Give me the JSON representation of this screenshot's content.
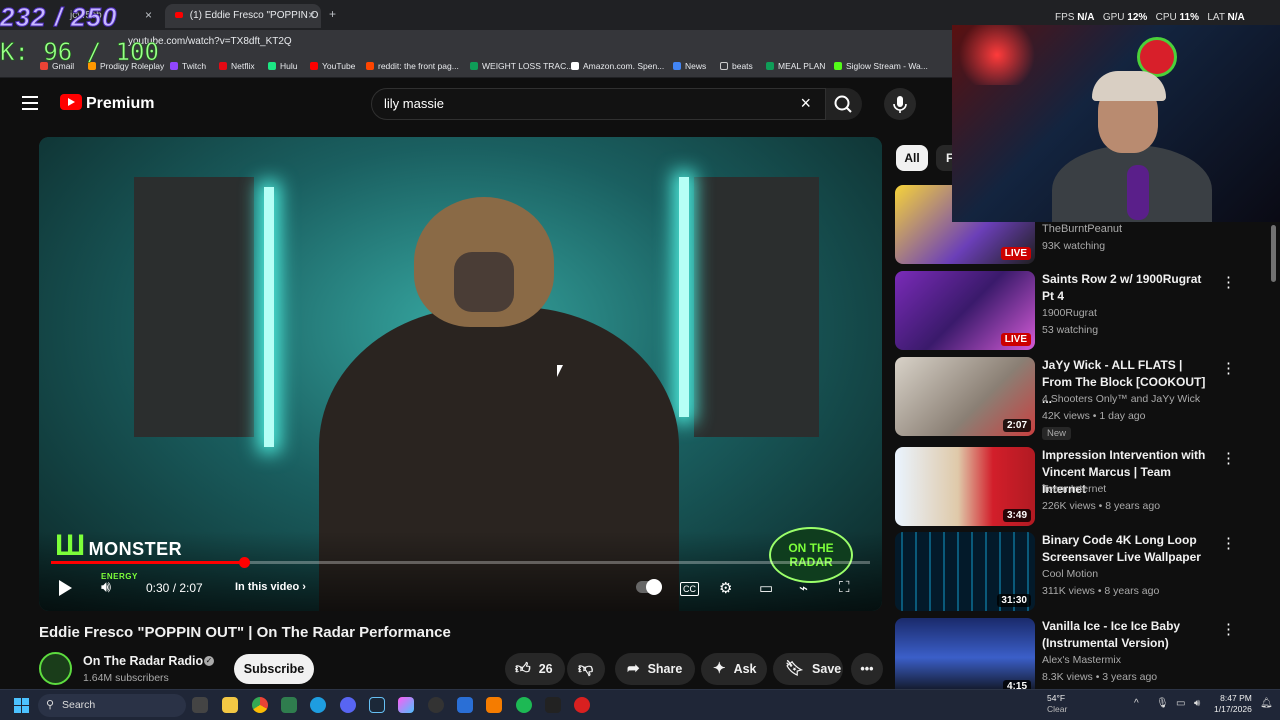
{
  "overlay": {
    "counter_top": "232 / 250",
    "counter_bottom": "K: 96 / 100",
    "perf": [
      {
        "label": "FPS",
        "value": "N/A"
      },
      {
        "label": "GPU",
        "value": "12%"
      },
      {
        "label": "CPU",
        "value": "11%"
      },
      {
        "label": "LAT",
        "value": "N/A"
      }
    ]
  },
  "browser": {
    "tabs": [
      {
        "label": "jcyr5sb",
        "active": false
      },
      {
        "label": "(1) Eddie Fresco \"POPPIN O",
        "active": true
      }
    ],
    "url": "youtube.com/watch?v=TX8dft_KT2Q",
    "bookmarks": [
      "Gmail",
      "Prodigy Roleplay",
      "Twitch",
      "Netflix",
      "Hulu",
      "YouTube",
      "reddit: the front pag...",
      "WEIGHT LOSS TRAC...",
      "Amazon.com. Spen...",
      "News",
      "beats",
      "MEAL PLAN",
      "Siglow Stream - Wa..."
    ]
  },
  "header": {
    "brand": "Premium",
    "search_value": "lily massie"
  },
  "player": {
    "current_time": "0:30",
    "duration": "2:07",
    "time_display": "0:30 / 2:07",
    "progress_fraction": 0.236,
    "chapters_label": "In this video",
    "sponsor_text": "MONSTER",
    "sponsor_sub": "ENERGY",
    "watermark": "ON THE RADAR"
  },
  "video": {
    "title": "Eddie Fresco \"POPPIN OUT\" | On The Radar Performance",
    "channel": "On The Radar Radio",
    "subscribers": "1.64M subscribers",
    "subscribe_label": "Subscribe",
    "likes": "26",
    "share_label": "Share",
    "ask_label": "Ask",
    "save_label": "Save"
  },
  "sidebar": {
    "chips": [
      "All",
      "F"
    ],
    "items": [
      {
        "title": "",
        "channel": "TheBurntPeanut",
        "meta": "93K watching",
        "badge": "LIVE",
        "live": true
      },
      {
        "title": "Saints Row 2 w/ 1900Rugrat Pt 4",
        "channel": "1900Rugrat",
        "meta": "53 watching",
        "badge": "LIVE",
        "live": true
      },
      {
        "title": "JaYy Wick - ALL FLATS | From The Block [COOKOUT] ...",
        "channel": "4 Shooters Only™ and JaYy Wick",
        "meta": "42K views • 1 day ago",
        "badge": "2:07",
        "tag": "New"
      },
      {
        "title": "Impression Intervention with Vincent Marcus | Team Internet",
        "channel": "Team Internet",
        "meta": "226K views • 8 years ago",
        "badge": "3:49"
      },
      {
        "title": "Binary Code 4K Long Loop Screensaver Live Wallpaper",
        "channel": "Cool Motion",
        "meta": "311K views • 8 years ago",
        "badge": "31:30"
      },
      {
        "title": "Vanilla Ice - Ice Ice Baby (Instrumental Version)",
        "channel": "Alex's Mastermix",
        "meta": "8.3K views • 3 years ago",
        "badge": "4:15"
      }
    ]
  },
  "taskbar": {
    "search_placeholder": "Search",
    "temperature": "54°F",
    "weather": "Clear",
    "time": "8:47 PM",
    "date": "1/17/2026"
  },
  "colors": {
    "yt_red": "#ff0000",
    "background": "#0f0f0f",
    "accent_green": "#7cff3a"
  }
}
